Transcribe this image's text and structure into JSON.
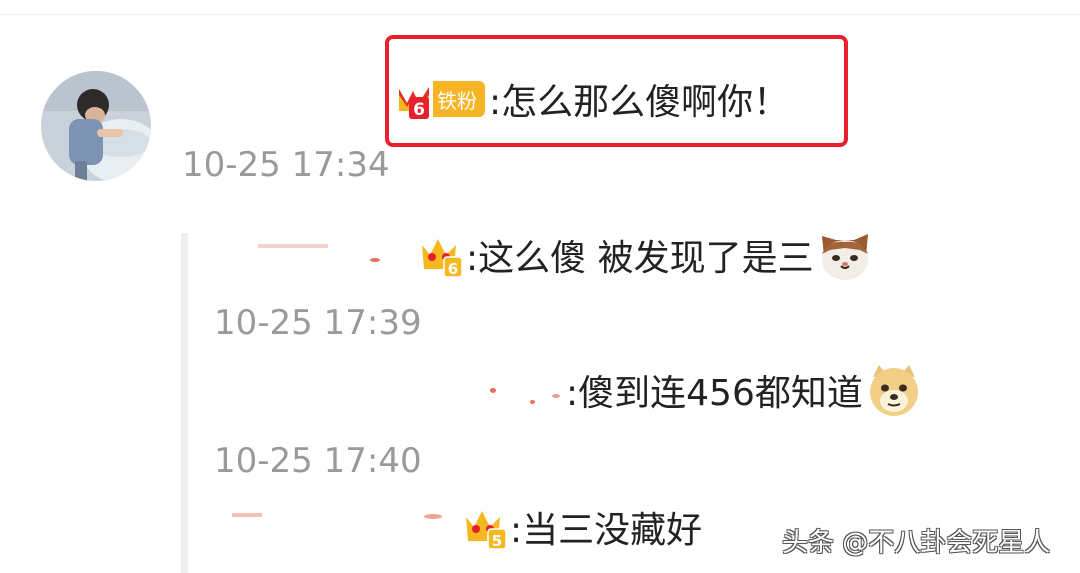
{
  "colors": {
    "highlight": "#e8202c",
    "timestamp": "#9a9a9a",
    "text": "#222222",
    "badge_gold": "#f7b425"
  },
  "main_comment": {
    "badge_label": "铁粉",
    "badge_level": "6",
    "text": ":怎么那么傻啊你！",
    "time": "10-25 17:34"
  },
  "replies": [
    {
      "level": "6",
      "text": ":这么傻 被发现了是三",
      "emoji": "cat-emoji",
      "time": "10-25 17:39"
    },
    {
      "level": "",
      "text": ":傻到连456都知道",
      "emoji": "doge-emoji",
      "time": "10-25 17:40"
    },
    {
      "level": "5",
      "text": ":当三没藏好",
      "emoji": "",
      "time": ""
    }
  ],
  "watermark": "头条 @不八卦会死星人"
}
